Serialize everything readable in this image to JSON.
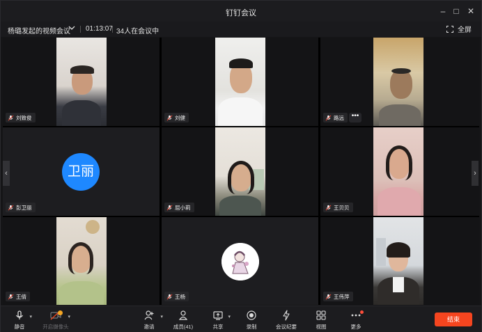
{
  "window": {
    "title": "钉钉会议"
  },
  "info": {
    "meeting_name": "杨璐发起的视频会议",
    "duration": "01:13:07",
    "participants": "34人在会议中",
    "fullscreen_label": "全屏"
  },
  "tiles": [
    {
      "name": "刘致俊"
    },
    {
      "name": "刘健"
    },
    {
      "name": "路远"
    },
    {
      "name": "彭卫丽",
      "avatar_text": "卫丽"
    },
    {
      "name": "屈小莉"
    },
    {
      "name": "王贝贝"
    },
    {
      "name": "王倩"
    },
    {
      "name": "王杨"
    },
    {
      "name": "王伟萍"
    }
  ],
  "more_label": "•••",
  "toolbar": {
    "mute": "静音",
    "camera": "开启摄像头",
    "invite": "邀请",
    "members": "成员(41)",
    "share": "共享",
    "record": "录制",
    "minutes": "会议纪要",
    "view": "视图",
    "more": "更多",
    "end": "结束"
  },
  "colors": {
    "end_button": "#f5451f",
    "avatar_blue": "#1e88ff",
    "badge_red": "#ff4d3a"
  }
}
